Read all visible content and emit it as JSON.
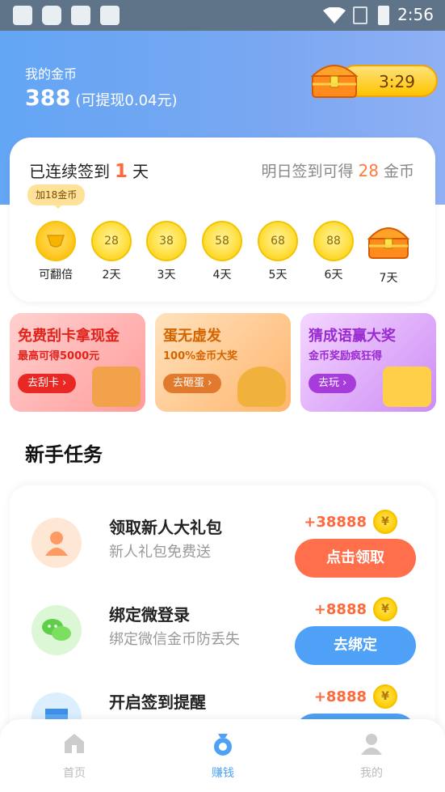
{
  "status_bar": {
    "time": "2:56"
  },
  "header": {
    "coin_label": "我的金币",
    "coin_amount": "388",
    "withdraw_hint": "(可提现0.04元)",
    "timer": "3:29"
  },
  "signin": {
    "streak_prefix": "已连续签到",
    "streak_days": "1",
    "streak_unit": "天",
    "tomorrow_prefix": "明日签到可得",
    "tomorrow_amount": "28",
    "tomorrow_unit": "金币",
    "tip": "加18金币",
    "days": [
      {
        "value": "",
        "label": "可翻倍"
      },
      {
        "value": "28",
        "label": "2天"
      },
      {
        "value": "38",
        "label": "3天"
      },
      {
        "value": "58",
        "label": "4天"
      },
      {
        "value": "68",
        "label": "5天"
      },
      {
        "value": "88",
        "label": "6天"
      },
      {
        "value": "",
        "label": "7天"
      }
    ]
  },
  "banners": [
    {
      "title": "免费刮卡拿现金",
      "subtitle": "最高可得5000元",
      "button": "去刮卡 ›"
    },
    {
      "title": "蛋无虚发",
      "subtitle": "100%金币大奖",
      "button": "去砸蛋 ›"
    },
    {
      "title": "猜成语赢大奖",
      "subtitle": "金币奖励疯狂得",
      "button": "去玩 ›"
    }
  ],
  "tasks_section": {
    "title": "新手任务",
    "items": [
      {
        "title": "领取新人大礼包",
        "desc": "新人礼包免费送",
        "reward": "+38888",
        "button": "点击领取"
      },
      {
        "title": "绑定微登录",
        "desc": "绑定微信金币防丢失",
        "reward": "+8888",
        "button": "去绑定"
      },
      {
        "title": "开启签到提醒",
        "desc": "",
        "reward": "+8888",
        "button": ""
      }
    ]
  },
  "bottom_nav": [
    {
      "label": "首页"
    },
    {
      "label": "赚钱"
    },
    {
      "label": "我的"
    }
  ],
  "colors": {
    "accent_blue": "#4ea1f6",
    "accent_orange": "#ff6f4b",
    "coin_gold": "#ffcc00"
  }
}
